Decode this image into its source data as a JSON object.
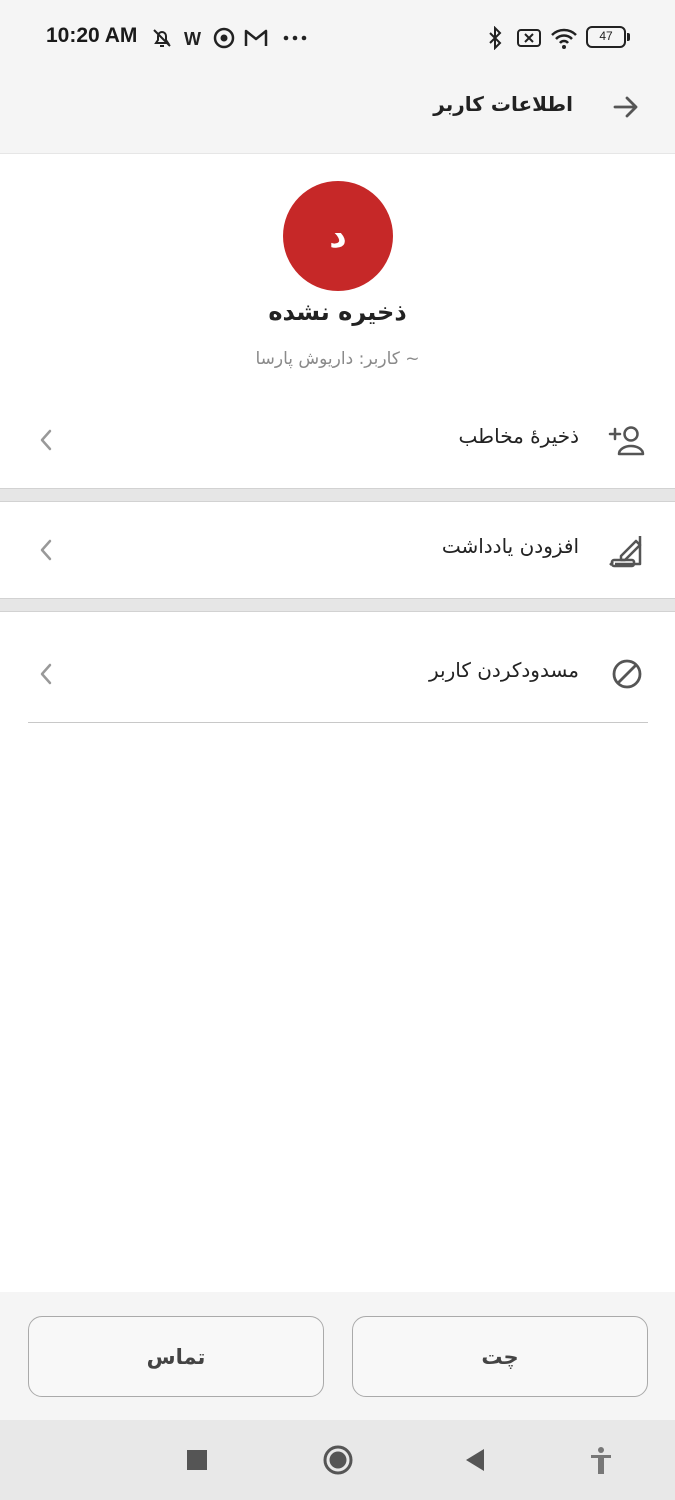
{
  "status_bar": {
    "time": "10:20 AM",
    "battery_level": "47",
    "left_icons": [
      "muted-bell-icon",
      "w-app-icon",
      "chrome-icon",
      "gmail-icon",
      "more-dots-icon"
    ],
    "right_icons": [
      "bluetooth-icon",
      "no-sim-icon",
      "wifi-icon",
      "battery-icon"
    ]
  },
  "app_bar": {
    "title": "اطلاعات کاربر",
    "back_icon": "arrow-right-icon"
  },
  "profile": {
    "avatar_letter": "د",
    "avatar_color": "#c62828",
    "name": "ذخیره نشده",
    "username": "~ کاربر: داریوش پارسا"
  },
  "actions": [
    {
      "label": "ذخیرهٔ مخاطب",
      "icon": "add-contact-icon"
    },
    {
      "label": "افزودن یادداشت",
      "icon": "note-edit-icon"
    },
    {
      "label": "مسدودکردن کاربر",
      "icon": "block-icon"
    }
  ],
  "bottom_buttons": {
    "call_label": "تماس",
    "chat_label": "چت"
  },
  "nav_bar": {
    "icons": [
      "recents-square-icon",
      "home-circle-icon",
      "back-triangle-icon",
      "accessibility-icon"
    ]
  }
}
